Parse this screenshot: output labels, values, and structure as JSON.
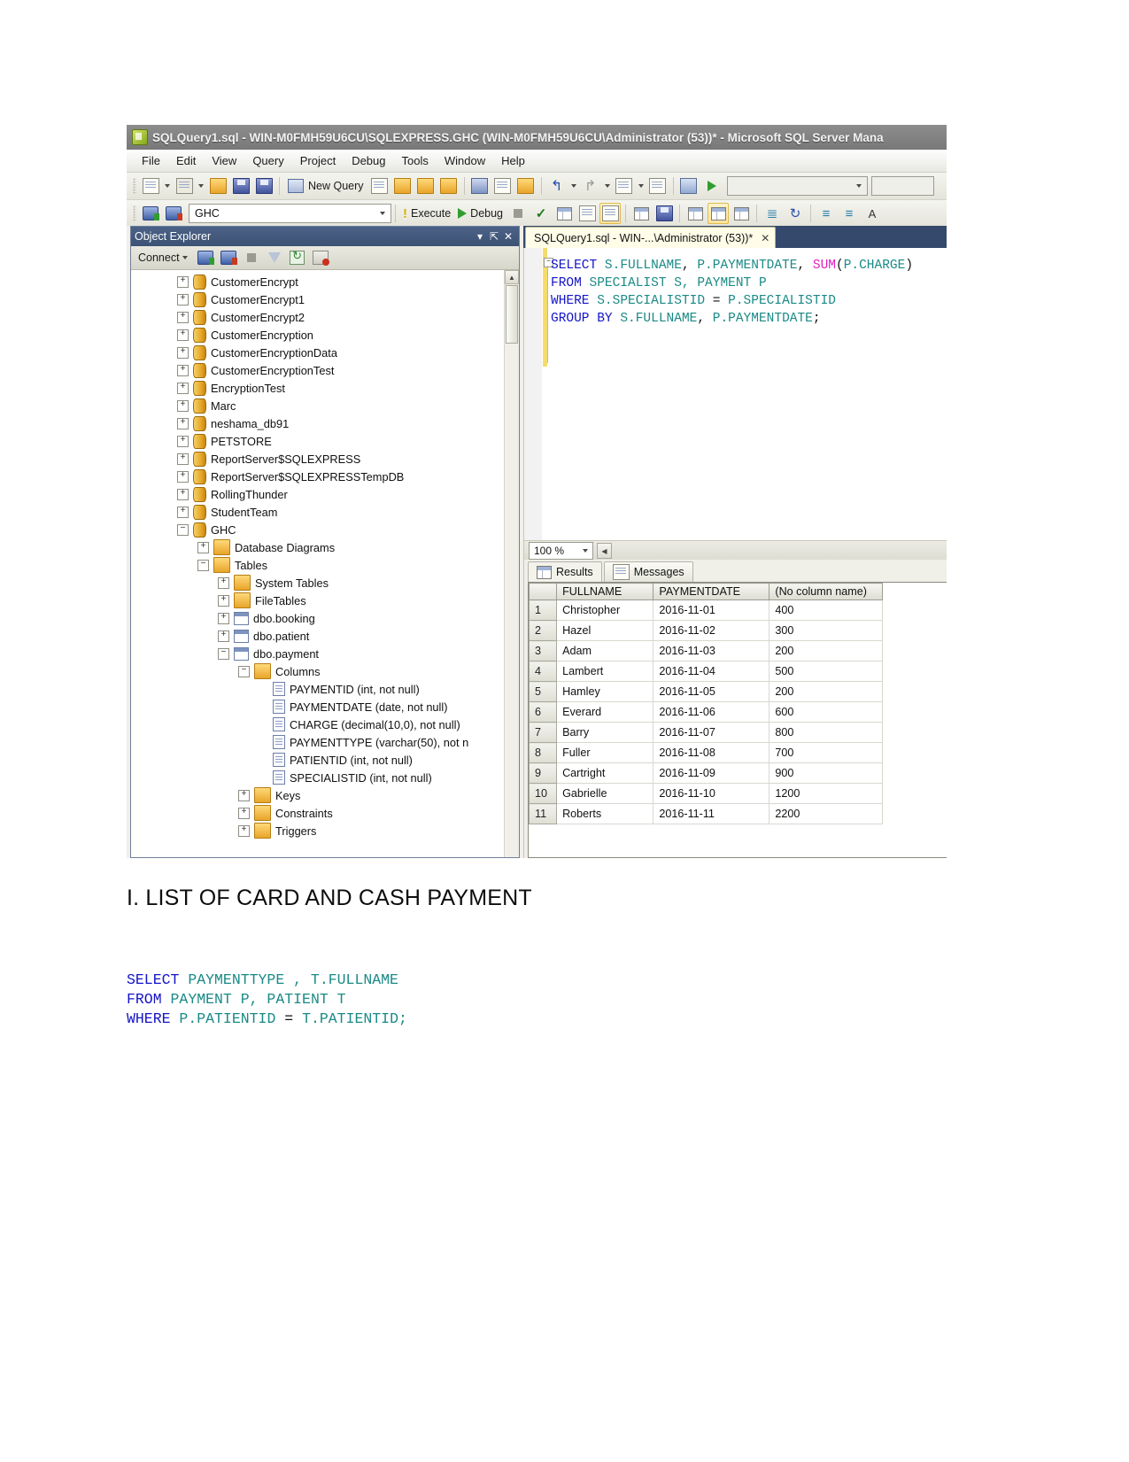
{
  "window": {
    "title": "SQLQuery1.sql - WIN-M0FMH59U6CU\\SQLEXPRESS.GHC (WIN-M0FMH59U6CU\\Administrator (53))* - Microsoft SQL Server Mana"
  },
  "menu": {
    "items": [
      "File",
      "Edit",
      "View",
      "Query",
      "Project",
      "Debug",
      "Tools",
      "Window",
      "Help"
    ]
  },
  "toolbar": {
    "new_query_label": "New Query",
    "database_value": "GHC",
    "execute_label": "Execute",
    "debug_label": "Debug",
    "combo_empty_value": ""
  },
  "object_explorer": {
    "title": "Object Explorer",
    "connect_label": "Connect",
    "nodes": [
      {
        "label": "CustomerEncrypt",
        "indent": 1,
        "state": "+",
        "icon": "database-icon"
      },
      {
        "label": "CustomerEncrypt1",
        "indent": 1,
        "state": "+",
        "icon": "database-icon"
      },
      {
        "label": "CustomerEncrypt2",
        "indent": 1,
        "state": "+",
        "icon": "database-icon"
      },
      {
        "label": "CustomerEncryption",
        "indent": 1,
        "state": "+",
        "icon": "database-icon"
      },
      {
        "label": "CustomerEncryptionData",
        "indent": 1,
        "state": "+",
        "icon": "database-icon"
      },
      {
        "label": "CustomerEncryptionTest",
        "indent": 1,
        "state": "+",
        "icon": "database-icon"
      },
      {
        "label": "EncryptionTest",
        "indent": 1,
        "state": "+",
        "icon": "database-icon"
      },
      {
        "label": "Marc",
        "indent": 1,
        "state": "+",
        "icon": "database-icon"
      },
      {
        "label": "neshama_db91",
        "indent": 1,
        "state": "+",
        "icon": "database-icon"
      },
      {
        "label": "PETSTORE",
        "indent": 1,
        "state": "+",
        "icon": "database-icon"
      },
      {
        "label": "ReportServer$SQLEXPRESS",
        "indent": 1,
        "state": "+",
        "icon": "database-icon"
      },
      {
        "label": "ReportServer$SQLEXPRESSTempDB",
        "indent": 1,
        "state": "+",
        "icon": "database-icon"
      },
      {
        "label": "RollingThunder",
        "indent": 1,
        "state": "+",
        "icon": "database-icon"
      },
      {
        "label": "StudentTeam",
        "indent": 1,
        "state": "+",
        "icon": "database-icon"
      },
      {
        "label": "GHC",
        "indent": 1,
        "state": "-",
        "icon": "database-icon"
      },
      {
        "label": "Database Diagrams",
        "indent": 2,
        "state": "+",
        "icon": "folder-icon"
      },
      {
        "label": "Tables",
        "indent": 2,
        "state": "-",
        "icon": "folder-icon"
      },
      {
        "label": "System Tables",
        "indent": 3,
        "state": "+",
        "icon": "folder-icon"
      },
      {
        "label": "FileTables",
        "indent": 3,
        "state": "+",
        "icon": "folder-icon"
      },
      {
        "label": "dbo.booking",
        "indent": 3,
        "state": "+",
        "icon": "table-icon"
      },
      {
        "label": "dbo.patient",
        "indent": 3,
        "state": "+",
        "icon": "table-icon"
      },
      {
        "label": "dbo.payment",
        "indent": 3,
        "state": "-",
        "icon": "table-icon"
      },
      {
        "label": "Columns",
        "indent": 4,
        "state": "-",
        "icon": "folder-icon"
      },
      {
        "label": "PAYMENTID (int, not null)",
        "indent": 5,
        "state": "",
        "icon": "column-icon"
      },
      {
        "label": "PAYMENTDATE (date, not null)",
        "indent": 5,
        "state": "",
        "icon": "column-icon"
      },
      {
        "label": "CHARGE (decimal(10,0), not null)",
        "indent": 5,
        "state": "",
        "icon": "column-icon"
      },
      {
        "label": "PAYMENTTYPE (varchar(50), not n",
        "indent": 5,
        "state": "",
        "icon": "column-icon"
      },
      {
        "label": "PATIENTID (int, not null)",
        "indent": 5,
        "state": "",
        "icon": "column-icon"
      },
      {
        "label": "SPECIALISTID (int, not null)",
        "indent": 5,
        "state": "",
        "icon": "column-icon"
      },
      {
        "label": "Keys",
        "indent": 4,
        "state": "+",
        "icon": "folder-icon"
      },
      {
        "label": "Constraints",
        "indent": 4,
        "state": "+",
        "icon": "folder-icon"
      },
      {
        "label": "Triggers",
        "indent": 4,
        "state": "+",
        "icon": "folder-icon"
      }
    ]
  },
  "editor": {
    "tab_label": "SQLQuery1.sql - WIN-...\\Administrator (53))*",
    "zoom_value": "100 %",
    "code_lines": [
      [
        {
          "t": "SELECT ",
          "c": "kw"
        },
        {
          "t": "S.FULLNAME",
          "c": "idn"
        },
        {
          "t": ", ",
          "c": "pn"
        },
        {
          "t": "P.PAYMENTDATE",
          "c": "idn"
        },
        {
          "t": ", ",
          "c": "pn"
        },
        {
          "t": "SUM",
          "c": "fn"
        },
        {
          "t": "(",
          "c": "pn"
        },
        {
          "t": "P.CHARGE",
          "c": "idn"
        },
        {
          "t": ")",
          "c": "pn"
        }
      ],
      [
        {
          "t": "FROM ",
          "c": "kw"
        },
        {
          "t": "SPECIALIST S, PAYMENT P",
          "c": "idn"
        }
      ],
      [
        {
          "t": "WHERE ",
          "c": "kw"
        },
        {
          "t": "S.SPECIALISTID",
          "c": "idn"
        },
        {
          "t": " = ",
          "c": "pn"
        },
        {
          "t": "P.SPECIALISTID",
          "c": "idn"
        }
      ],
      [
        {
          "t": "GROUP BY ",
          "c": "kw"
        },
        {
          "t": "S.FULLNAME",
          "c": "idn"
        },
        {
          "t": ", ",
          "c": "pn"
        },
        {
          "t": "P.PAYMENTDATE",
          "c": "idn"
        },
        {
          "t": ";",
          "c": "pn"
        }
      ]
    ]
  },
  "results": {
    "tabs": [
      {
        "label": "Results",
        "icon": "grid-icon",
        "selected": true
      },
      {
        "label": "Messages",
        "icon": "message-icon",
        "selected": false
      }
    ],
    "columns": [
      "FULLNAME",
      "PAYMENTDATE",
      "(No column name)"
    ],
    "rows": [
      {
        "n": "1",
        "cells": [
          "Christopher",
          "2016-11-01",
          "400"
        ]
      },
      {
        "n": "2",
        "cells": [
          "Hazel",
          "2016-11-02",
          "300"
        ]
      },
      {
        "n": "3",
        "cells": [
          "Adam",
          "2016-11-03",
          "200"
        ]
      },
      {
        "n": "4",
        "cells": [
          "Lambert",
          "2016-11-04",
          "500"
        ]
      },
      {
        "n": "5",
        "cells": [
          "Hamley",
          "2016-11-05",
          "200"
        ]
      },
      {
        "n": "6",
        "cells": [
          "Everard",
          "2016-11-06",
          "600"
        ]
      },
      {
        "n": "7",
        "cells": [
          "Barry",
          "2016-11-07",
          "800"
        ]
      },
      {
        "n": "8",
        "cells": [
          "Fuller",
          "2016-11-08",
          "700"
        ]
      },
      {
        "n": "9",
        "cells": [
          "Cartright",
          "2016-11-09",
          "900"
        ]
      },
      {
        "n": "10",
        "cells": [
          "Gabrielle",
          "2016-11-10",
          "1200"
        ]
      },
      {
        "n": "11",
        "cells": [
          "Roberts",
          "2016-11-11",
          "2200"
        ]
      }
    ]
  },
  "document": {
    "heading": "I. LIST OF CARD AND CASH PAYMENT",
    "sql_lines": [
      [
        {
          "t": "SELECT ",
          "c": "kw"
        },
        {
          "t": "PAYMENTTYPE , T.FULLNAME",
          "c": "idn"
        }
      ],
      [
        {
          "t": "FROM ",
          "c": "kw"
        },
        {
          "t": "PAYMENT P, PATIENT T",
          "c": "idn"
        }
      ],
      [
        {
          "t": "WHERE ",
          "c": "kw"
        },
        {
          "t": "P.PATIENTID",
          "c": "idn"
        },
        {
          "t": " = ",
          "c": "pn"
        },
        {
          "t": "T.PATIENTID",
          "c": "idn"
        },
        {
          "t": ";",
          "c": "idn"
        }
      ]
    ]
  },
  "colors": {
    "keyword": "#1414c8",
    "identifier": "#1a8a86",
    "function": "#e020c0",
    "titlebar": "#787878",
    "panel_header": "#3d5375"
  }
}
